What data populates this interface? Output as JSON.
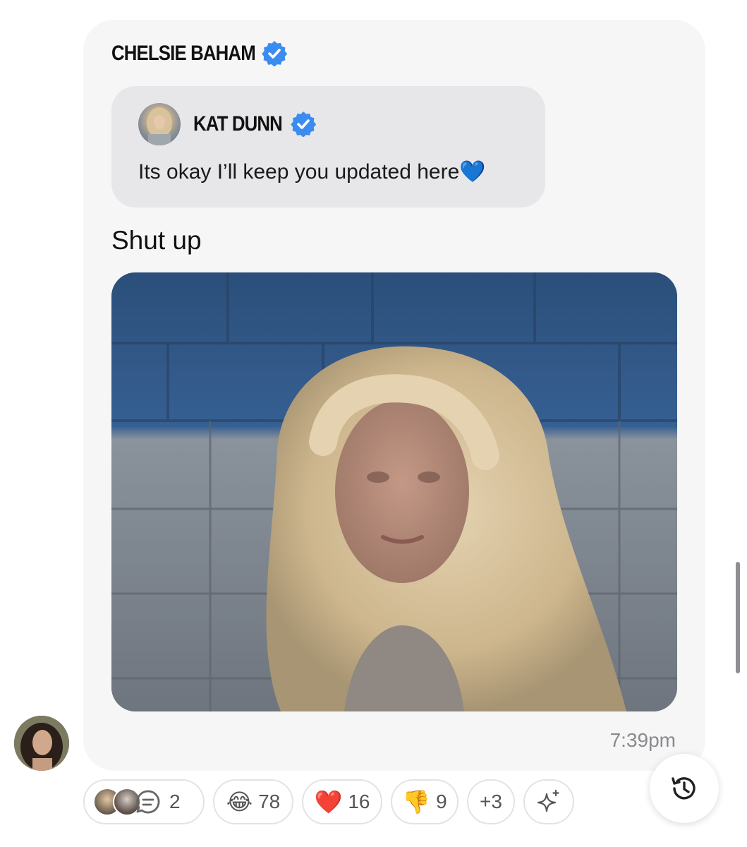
{
  "message": {
    "sender_name": "CHELSIE BAHAM",
    "quoted": {
      "author_name": "KAT DUNN",
      "text": "Its okay I’ll keep you updated here",
      "emoji": "💙"
    },
    "text": "Shut up",
    "timestamp": "7:39pm"
  },
  "reactions": {
    "replies_count": "2",
    "items": [
      {
        "emoji": "😂",
        "count": "78"
      },
      {
        "emoji": "❤️",
        "count": "16"
      },
      {
        "emoji": "👎",
        "count": "9"
      }
    ],
    "more": "+3"
  },
  "icons": {
    "verified": "verified-badge-icon",
    "chat": "chat-bubble-icon",
    "sparkle": "add-reaction-sparkle-icon",
    "history": "history-icon"
  },
  "colors": {
    "verified_blue": "#3b8cf0",
    "card_background": "#f6f6f7",
    "quote_background": "#e7e7e9"
  }
}
